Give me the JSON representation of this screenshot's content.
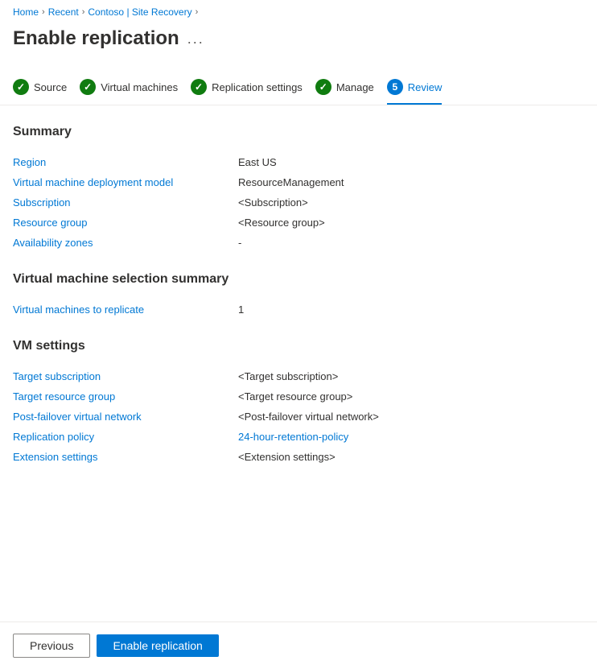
{
  "breadcrumb": {
    "home": "Home",
    "recent": "Recent",
    "contoso": "Contoso",
    "siteRecovery": "Site Recovery"
  },
  "page": {
    "title": "Enable replication",
    "menuIcon": "..."
  },
  "steps": [
    {
      "id": "source",
      "label": "Source",
      "state": "complete",
      "number": ""
    },
    {
      "id": "virtual-machines",
      "label": "Virtual machines",
      "state": "complete",
      "number": ""
    },
    {
      "id": "replication-settings",
      "label": "Replication settings",
      "state": "complete",
      "number": ""
    },
    {
      "id": "manage",
      "label": "Manage",
      "state": "complete",
      "number": ""
    },
    {
      "id": "review",
      "label": "Review",
      "state": "current",
      "number": "5"
    }
  ],
  "summary": {
    "title": "Summary",
    "rows": [
      {
        "label": "Region",
        "value": "East US",
        "isLink": false
      },
      {
        "label": "Virtual machine deployment model",
        "value": "ResourceManagement",
        "isLink": false
      },
      {
        "label": "Subscription",
        "value": "<Subscription>",
        "isLink": false
      },
      {
        "label": "Resource group",
        "value": "<Resource group>",
        "isLink": false
      },
      {
        "label": "Availability zones",
        "value": "-",
        "isLink": false
      }
    ]
  },
  "vmSelection": {
    "title": "Virtual machine selection summary",
    "rows": [
      {
        "label": "Virtual machines to replicate",
        "value": "1",
        "isLink": false
      }
    ]
  },
  "vmSettings": {
    "title": "VM settings",
    "rows": [
      {
        "label": "Target subscription",
        "value": "<Target subscription>",
        "isLink": false
      },
      {
        "label": "Target resource group",
        "value": "<Target resource group>",
        "isLink": false
      },
      {
        "label": "Post-failover virtual network",
        "value": "<Post-failover virtual network>",
        "isLink": false
      },
      {
        "label": "Replication policy",
        "value": "24-hour-retention-policy",
        "isLink": true
      },
      {
        "label": "Extension settings",
        "value": "<Extension settings>",
        "isLink": false
      }
    ]
  },
  "footer": {
    "previousLabel": "Previous",
    "enableLabel": "Enable replication"
  },
  "icons": {
    "checkmark": "✓",
    "ellipsis": "···"
  }
}
